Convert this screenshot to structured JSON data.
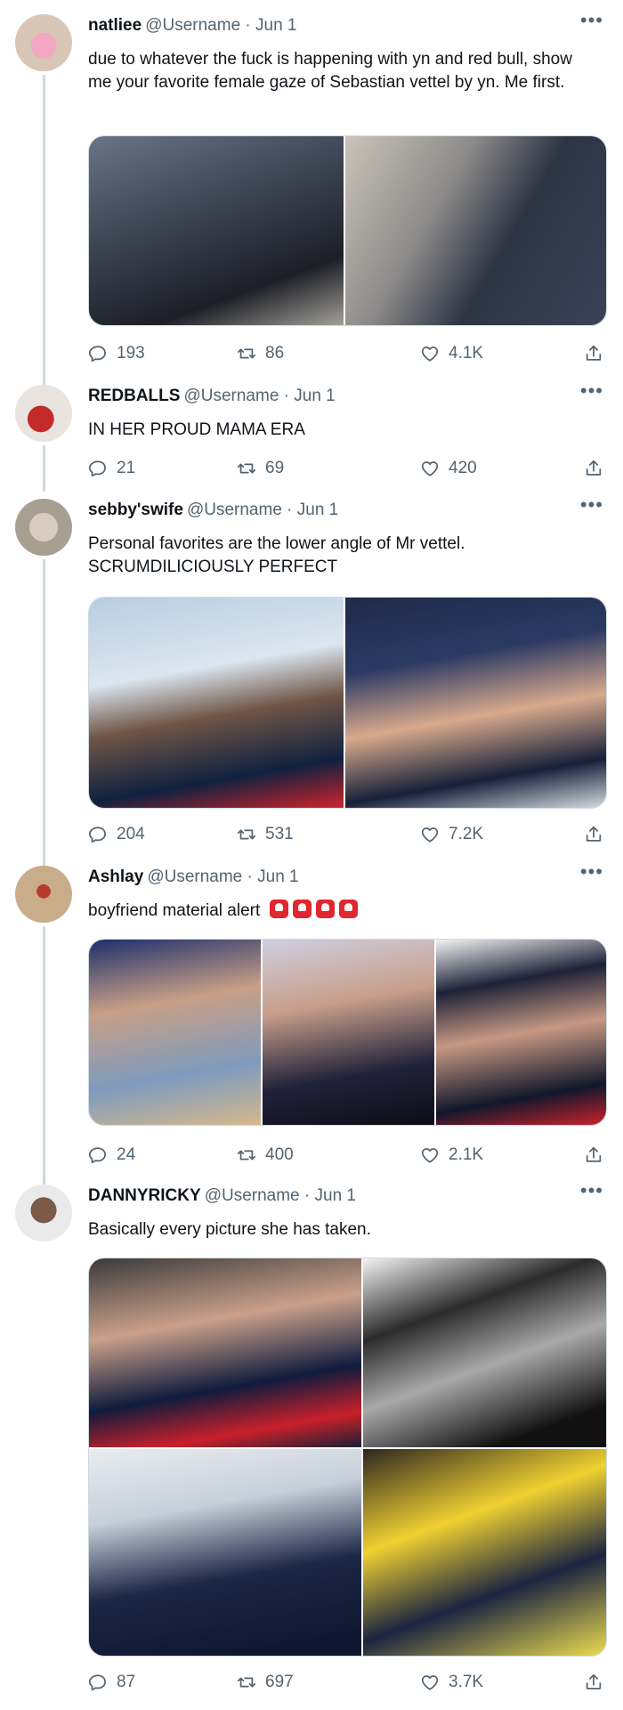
{
  "tweets": [
    {
      "name": "natliee",
      "meta": "@Username · Jun 1",
      "text": "due to whatever the fuck is happening with yn and red bull, show me your favorite female gaze of Sebastian vettel by yn. Me first.",
      "replies": "193",
      "retweets": "86",
      "likes": "4.1K"
    },
    {
      "name": "REDBALLS",
      "meta": "@Username · Jun 1",
      "text": "IN HER PROUD MAMA ERA",
      "replies": "21",
      "retweets": "69",
      "likes": "420"
    },
    {
      "name": "sebby'swife",
      "meta": "@Username · Jun 1",
      "text": "Personal favorites are the lower angle of Mr vettel. SCRUMDILICIOUSLY PERFECT",
      "replies": "204",
      "retweets": "531",
      "likes": "7.2K"
    },
    {
      "name": "Ashlay",
      "meta": "@Username · Jun 1",
      "text": "boyfriend material alert",
      "replies": "24",
      "retweets": "400",
      "likes": "2.1K"
    },
    {
      "name": "DANNYRICKY",
      "meta": "@Username · Jun 1",
      "text": "Basically every picture she has taken.",
      "replies": "87",
      "retweets": "697",
      "likes": "3.7K"
    }
  ],
  "icons": {
    "more": "more-icon",
    "reply": "reply-icon",
    "retweet": "retweet-icon",
    "like": "heart-icon",
    "share": "share-icon",
    "emoji": "siren-emoji"
  },
  "colors": {
    "text": "#0f1419",
    "secondary": "#536471",
    "thread_line": "#cfd9de"
  }
}
